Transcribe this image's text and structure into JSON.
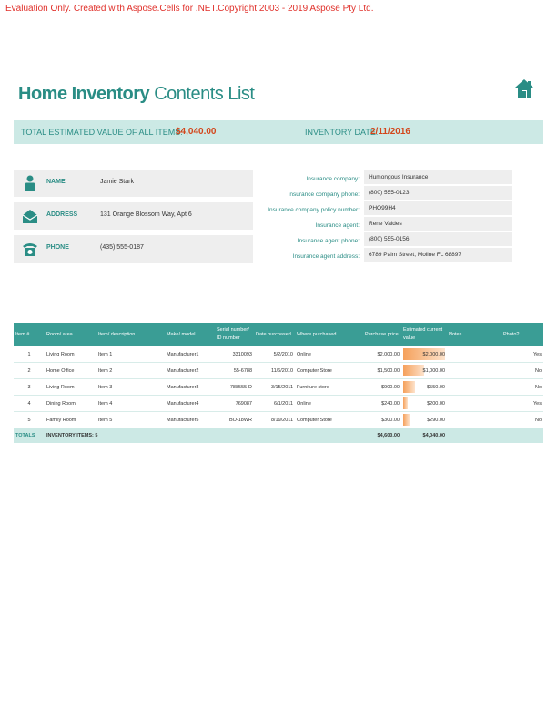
{
  "watermark": "Evaluation Only. Created with Aspose.Cells for .NET.Copyright 2003 - 2019 Aspose Pty Ltd.",
  "title": {
    "bold": "Home Inventory",
    "rest": " Contents List"
  },
  "summary": {
    "total_label": "TOTAL ESTIMATED VALUE OF ALL ITEMS:",
    "total_value": "$4,040.00",
    "date_label": "INVENTORY DATE:",
    "date_value": "2/11/2016"
  },
  "contact": {
    "name_label": "NAME",
    "name_value": "Jamie Stark",
    "address_label": "ADDRESS",
    "address_value": "131 Orange Blossom Way, Apt 6",
    "phone_label": "PHONE",
    "phone_value": "(435) 555-0187"
  },
  "insurance": [
    {
      "label": "Insurance company:",
      "value": "Humongous Insurance"
    },
    {
      "label": "Insurance company phone:",
      "value": "(800) 555-0123"
    },
    {
      "label": "Insurance company policy number:",
      "value": "PHO99H4"
    },
    {
      "label": "Insurance agent:",
      "value": "Rene Valdes"
    },
    {
      "label": "Insurance agent phone:",
      "value": "(800) 555-0156"
    },
    {
      "label": "Insurance agent address:",
      "value": "6789 Palm Street, Moline FL 68897"
    }
  ],
  "table": {
    "headers": [
      "Item #",
      "Room/ area",
      "Item/ description",
      "Make/ model",
      "Serial number/ ID number",
      "Date purchased",
      "Where purchased",
      "Purchase price",
      "Estimated current value",
      "Notes",
      "Photo?"
    ],
    "rows": [
      {
        "num": "1",
        "room": "Living Room",
        "item": "Item 1",
        "make": "Manufacturer1",
        "serial": "3310093",
        "date": "5/2/2010",
        "where": "Online",
        "price": "$2,000.00",
        "value": "$2,000.00",
        "value_fraction": 1.0,
        "notes": "",
        "photo": "Yes"
      },
      {
        "num": "2",
        "room": "Home Office",
        "item": "Item 2",
        "make": "Manufacturer2",
        "serial": "55-6788",
        "date": "11/6/2010",
        "where": "Computer Store",
        "price": "$1,500.00",
        "value": "$1,000.00",
        "value_fraction": 0.5,
        "notes": "",
        "photo": "No"
      },
      {
        "num": "3",
        "room": "Living Room",
        "item": "Item 3",
        "make": "Manufacturer3",
        "serial": "788555-D",
        "date": "3/15/2011",
        "where": "Furniture store",
        "price": "$900.00",
        "value": "$550.00",
        "value_fraction": 0.275,
        "notes": "",
        "photo": "No"
      },
      {
        "num": "4",
        "room": "Dining Room",
        "item": "Item 4",
        "make": "Manufacturer4",
        "serial": "769087",
        "date": "6/1/2011",
        "where": "Online",
        "price": "$240.00",
        "value": "$200.00",
        "value_fraction": 0.1,
        "notes": "",
        "photo": "Yes"
      },
      {
        "num": "5",
        "room": "Family Room",
        "item": "Item 5",
        "make": "Manufacturer5",
        "serial": "BO-18WR",
        "date": "8/19/2011",
        "where": "Computer Store",
        "price": "$300.00",
        "value": "$290.00",
        "value_fraction": 0.145,
        "notes": "",
        "photo": "No"
      }
    ],
    "totals": {
      "label": "TOTALS",
      "count_text": "INVENTORY ITEMS: 5",
      "price": "$4,600.00",
      "value": "$4,040.00"
    }
  },
  "colors": {
    "teal": "#3a9d95",
    "teal_dark": "#2a8d85",
    "teal_light": "#cce9e5",
    "accent_orange": "#d3461b",
    "bar": "#f5a05a",
    "gray_box": "#eeeeee"
  },
  "icons": {
    "home": "home-icon",
    "person": "person-icon",
    "envelope": "envelope-icon",
    "phone": "phone-icon"
  }
}
